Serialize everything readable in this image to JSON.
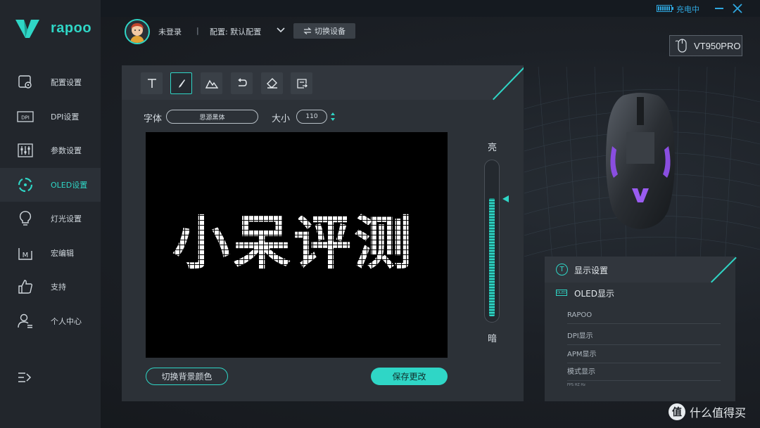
{
  "brand": {
    "name": "rapoo"
  },
  "window": {
    "charging_label": "充电中"
  },
  "sidebar": {
    "items": [
      {
        "label": "配置设置",
        "icon": "profile-settings-icon"
      },
      {
        "label": "DPI设置",
        "icon": "dpi-icon"
      },
      {
        "label": "参数设置",
        "icon": "sliders-icon"
      },
      {
        "label": "OLED设置",
        "icon": "oled-icon",
        "active": true
      },
      {
        "label": "灯光设置",
        "icon": "bulb-icon"
      },
      {
        "label": "宏编辑",
        "icon": "macro-icon"
      },
      {
        "label": "支持",
        "icon": "thumbs-up-icon"
      },
      {
        "label": "个人中心",
        "icon": "user-icon"
      }
    ]
  },
  "header": {
    "login_label": "未登录",
    "separator": "|",
    "profile_label": "配置: 默认配置",
    "switch_device_label": "切换设备",
    "device_name": "VT950PRO"
  },
  "editor": {
    "font_label": "字体",
    "font_value": "思源黑体",
    "size_label": "大小",
    "size_value": "110",
    "canvas_text": "小呆评测",
    "bright_label": "亮",
    "dark_label": "暗",
    "brightness_level": 0.78,
    "bg_color_button": "切换背景颜色",
    "save_button": "保存更改"
  },
  "display_settings": {
    "title": "显示设置",
    "oled_icon_text": "OLED",
    "oled_title": "OLED显示",
    "items": [
      "RAPOO",
      "DPI显示",
      "APM显示",
      "模式显示"
    ],
    "partial_item": "FPS HZ Hz"
  },
  "watermark": {
    "badge": "值",
    "text": "什么值得买"
  },
  "colors": {
    "accent": "#2fd6c6",
    "battery": "#2fa8e0"
  }
}
